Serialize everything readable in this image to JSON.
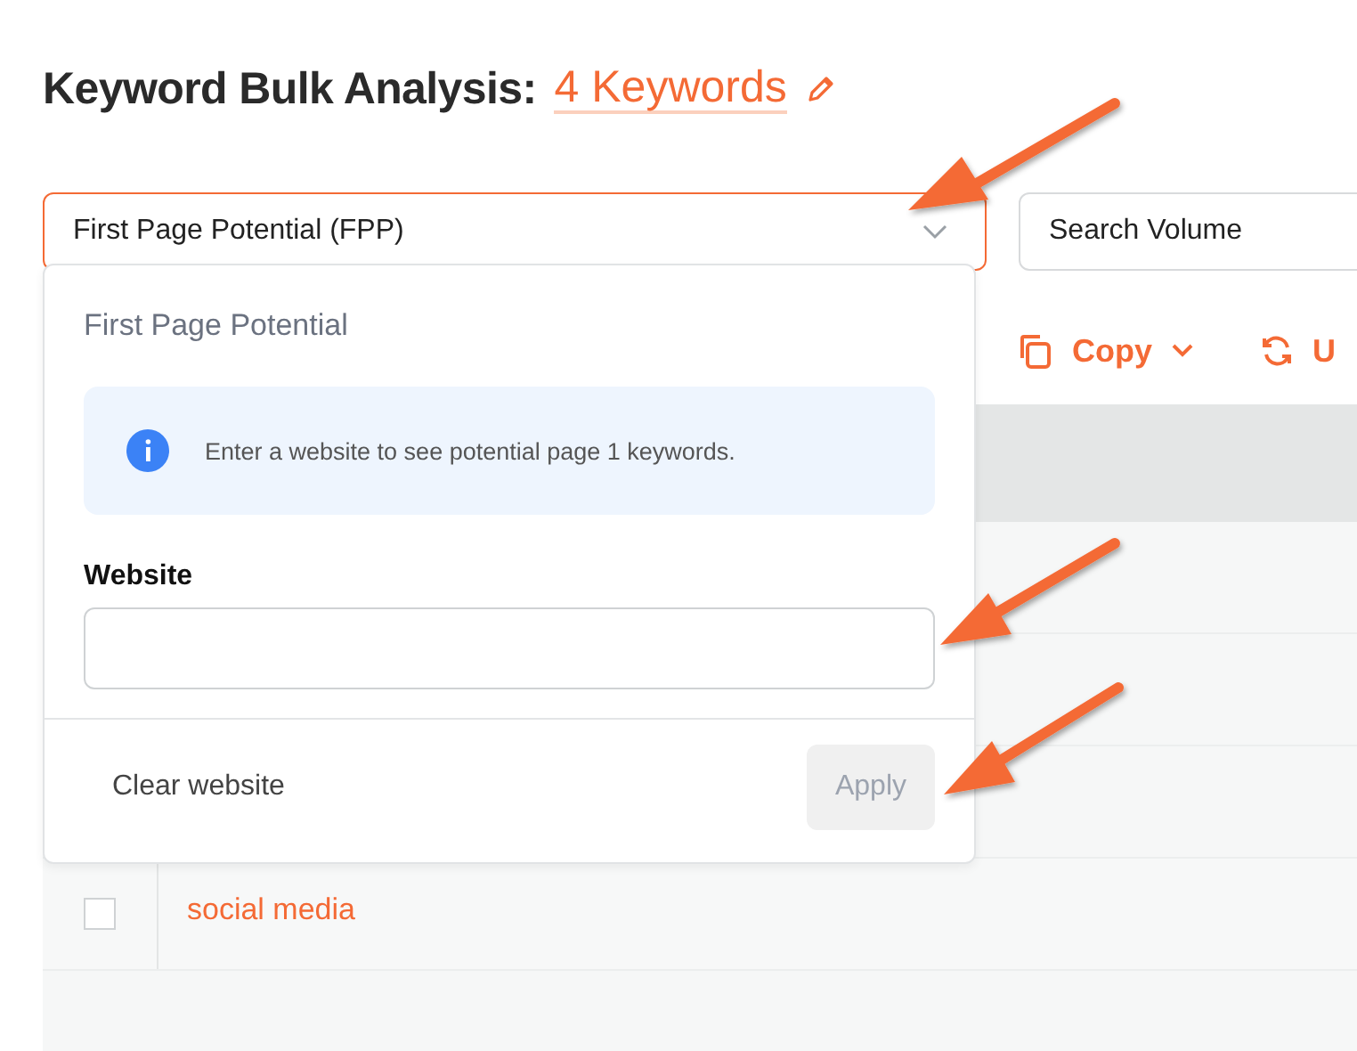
{
  "title": {
    "text": "Keyword Bulk Analysis:",
    "count_link": "4 Keywords"
  },
  "filters": [
    {
      "kind": "dropdown",
      "value": "First Page Potential (FPP)",
      "expanded": true
    },
    {
      "kind": "dropdown",
      "value": "Search Volume",
      "expanded": false
    }
  ],
  "toolbar": [
    {
      "kind": "copy",
      "label": "Copy"
    },
    {
      "kind": "refresh",
      "label": "U"
    }
  ],
  "popup": {
    "heading": "First Page Potential",
    "info": "Enter a website to see potential page 1 keywords.",
    "field_label": "Website",
    "buttons": [
      {
        "label": "Clear website",
        "disabled": false
      },
      {
        "label": "Apply",
        "disabled": true
      }
    ]
  },
  "table": {
    "rows": [
      {
        "keyword": "social media",
        "checked": false
      }
    ]
  }
}
